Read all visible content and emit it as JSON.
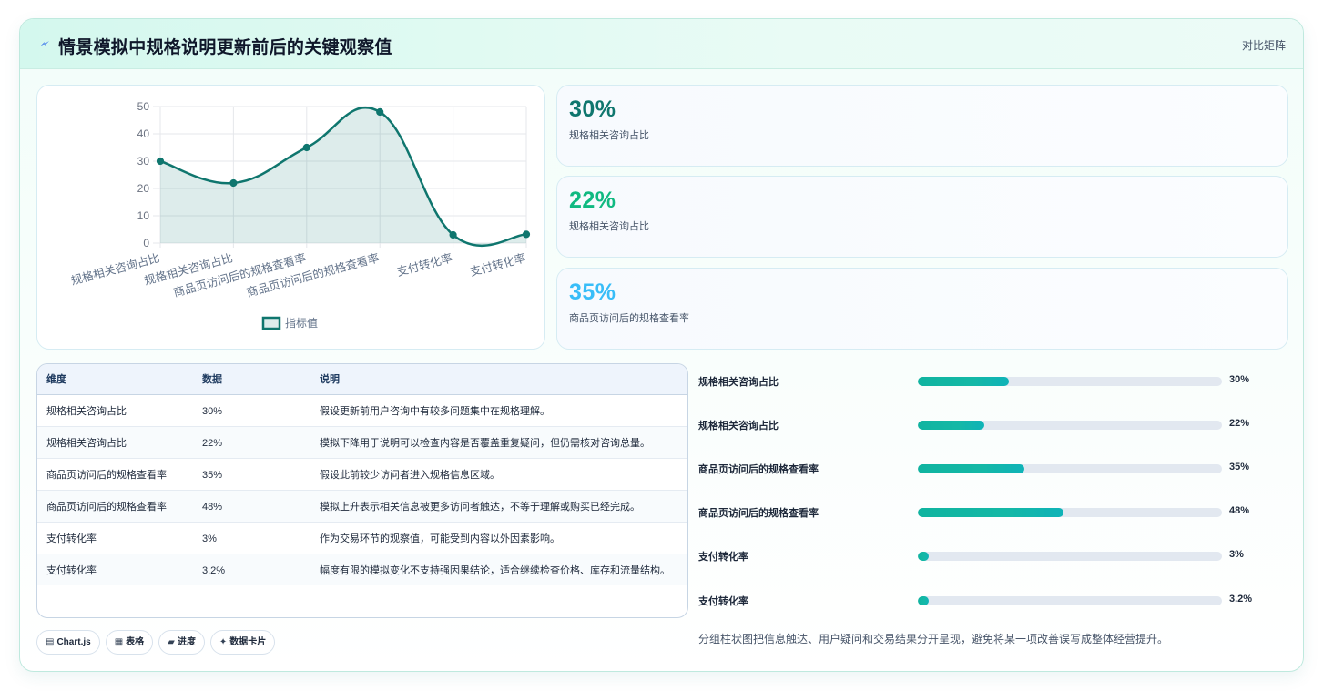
{
  "header": {
    "title": "情景模拟中规格说明更新前后的关键观察值",
    "link": "对比矩阵"
  },
  "chart_data": {
    "type": "line",
    "categories": [
      "规格相关咨询占比",
      "规格相关咨询占比",
      "商品页访问后的规格查看率",
      "商品页访问后的规格查看率",
      "支付转化率",
      "支付转化率"
    ],
    "series": [
      {
        "name": "指标值",
        "values": [
          30,
          22,
          35,
          48,
          3,
          3.2
        ],
        "color": "#0f766e"
      }
    ],
    "ylim": [
      0,
      50
    ],
    "yticks": [
      "0",
      "10",
      "20",
      "30",
      "40",
      "50"
    ],
    "grid": true,
    "legend": "bottom",
    "fill": true
  },
  "stats": [
    {
      "value": "30%",
      "label": "规格相关咨询占比",
      "color": "#0f766e"
    },
    {
      "value": "22%",
      "label": "规格相关咨询占比",
      "color": "#10b981"
    },
    {
      "value": "35%",
      "label": "商品页访问后的规格查看率",
      "color": "#38bdf8"
    }
  ],
  "table": {
    "headers": [
      "维度",
      "数据",
      "说明"
    ],
    "rows": [
      [
        "规格相关咨询占比",
        "30%",
        "假设更新前用户咨询中有较多问题集中在规格理解。"
      ],
      [
        "规格相关咨询占比",
        "22%",
        "模拟下降用于说明可以检查内容是否覆盖重复疑问，但仍需核对咨询总量。"
      ],
      [
        "商品页访问后的规格查看率",
        "35%",
        "假设此前较少访问者进入规格信息区域。"
      ],
      [
        "商品页访问后的规格查看率",
        "48%",
        "模拟上升表示相关信息被更多访问者触达，不等于理解或购买已经完成。"
      ],
      [
        "支付转化率",
        "3%",
        "作为交易环节的观察值，可能受到内容以外因素影响。"
      ],
      [
        "支付转化率",
        "3.2%",
        "幅度有限的模拟变化不支持强因果结论，适合继续检查价格、库存和流量结构。"
      ]
    ]
  },
  "tags": [
    {
      "icon": "chart-icon",
      "glyph": "▤",
      "label": "Chart.js"
    },
    {
      "icon": "table-icon",
      "glyph": "▦",
      "label": "表格"
    },
    {
      "icon": "progress-icon",
      "glyph": "▰",
      "label": "进度"
    },
    {
      "icon": "sparkle-icon",
      "glyph": "✦",
      "label": "数据卡片"
    }
  ],
  "progress": [
    {
      "label": "规格相关咨询占比",
      "value": 30,
      "display": "30%"
    },
    {
      "label": "规格相关咨询占比",
      "value": 22,
      "display": "22%"
    },
    {
      "label": "商品页访问后的规格查看率",
      "value": 35,
      "display": "35%"
    },
    {
      "label": "商品页访问后的规格查看率",
      "value": 48,
      "display": "48%"
    },
    {
      "label": "支付转化率",
      "value": 3,
      "display": "3%"
    },
    {
      "label": "支付转化率",
      "value": 3.2,
      "display": "3.2%"
    }
  ],
  "footnote": "分组柱状图把信息触达、用户疑问和交易结果分开呈现，避免将某一项改善误写成整体经营提升。"
}
